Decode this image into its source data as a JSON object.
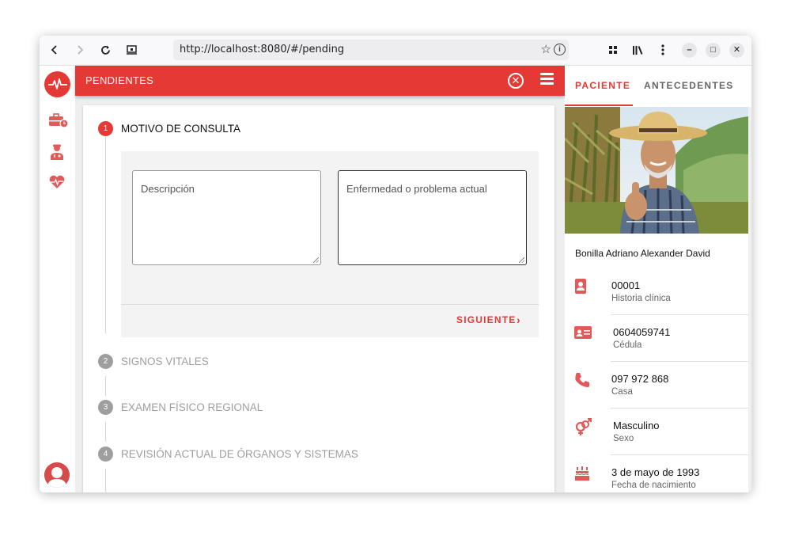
{
  "browser": {
    "url": "http://localhost:8080/#/pending"
  },
  "header": {
    "title": "PENDIENTES"
  },
  "steps": [
    {
      "num": "1",
      "label": "MOTIVO DE CONSULTA",
      "state": "active"
    },
    {
      "num": "2",
      "label": "SIGNOS VITALES",
      "state": "inactive"
    },
    {
      "num": "3",
      "label": "EXAMEN FÍSICO REGIONAL",
      "state": "inactive"
    },
    {
      "num": "4",
      "label": "REVISIÓN ACTUAL DE ÓRGANOS Y SISTEMAS",
      "state": "inactive"
    }
  ],
  "form": {
    "description_placeholder": "Descripción",
    "illness_placeholder": "Enfermedad o problema actual",
    "next_label": "SIGUIENTE"
  },
  "right_panel": {
    "tabs": [
      {
        "label": "PACIENTE",
        "active": true
      },
      {
        "label": "ANTECEDENTES",
        "active": false
      }
    ],
    "patient_name": "Bonilla Adriano Alexander David",
    "info": [
      {
        "icon": "contact-card-icon",
        "value": "00001",
        "label": "Historia clínica"
      },
      {
        "icon": "id-card-icon",
        "value": "0604059741",
        "label": "Cédula"
      },
      {
        "icon": "phone-icon",
        "value": "097 972 868",
        "label": "Casa"
      },
      {
        "icon": "gender-icon",
        "value": "Masculino",
        "label": "Sexo"
      },
      {
        "icon": "birthday-cake-icon",
        "value": "3 de mayo de 1993",
        "label": "Fecha de nacimiento"
      }
    ]
  },
  "colors": {
    "accent": "#e53935",
    "inactive": "#9e9e9e",
    "background": "#eeeeee"
  }
}
